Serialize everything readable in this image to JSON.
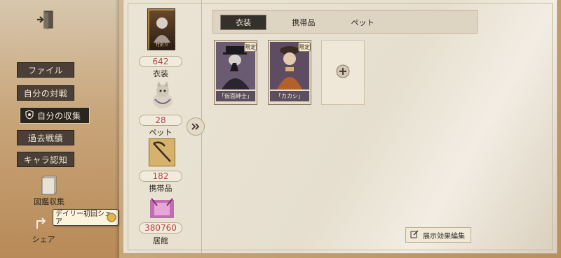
{
  "nav": {
    "items": [
      {
        "label": "ファイル"
      },
      {
        "label": "自分の対戦"
      },
      {
        "label": "自分の収集"
      },
      {
        "label": "過去戦績"
      },
      {
        "label": "キャラ認知"
      }
    ],
    "active_index": 2,
    "collection_label": "図鑑収集",
    "share_label": "シェア",
    "share_tooltip": "デイリー初回シェア"
  },
  "stats": {
    "portrait_tag": "竹折り",
    "costume": {
      "count": "642",
      "label": "衣装"
    },
    "pet": {
      "count": "28",
      "label": "ペット"
    },
    "item": {
      "count": "182",
      "label": "携帯品"
    },
    "residence": {
      "count": "380760",
      "label": "居館"
    }
  },
  "tabs": [
    {
      "label": "衣装",
      "active": true
    },
    {
      "label": "携帯品",
      "active": false
    },
    {
      "label": "ペット",
      "active": false
    }
  ],
  "cards": [
    {
      "name": "「仮面紳士」",
      "badge": "限定"
    },
    {
      "name": "「カカシ」",
      "badge": "限定"
    }
  ],
  "edit_button": {
    "label": "展示効果編集"
  },
  "colors": {
    "accent_dark": "#34302c",
    "count_red": "#b64545",
    "paper": "#ebe4d5"
  }
}
